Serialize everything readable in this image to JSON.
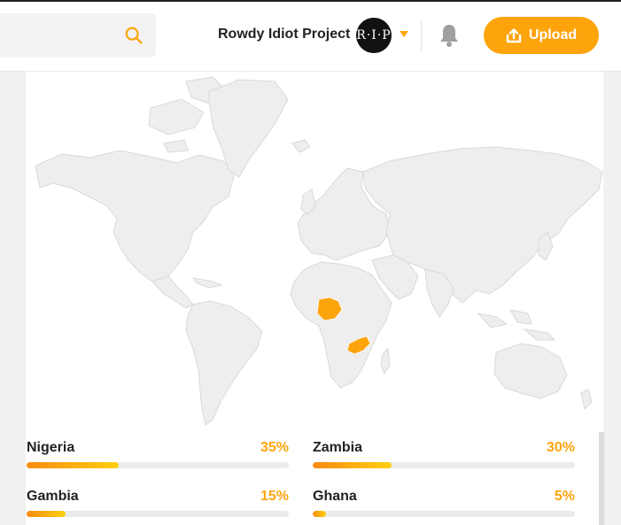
{
  "header": {
    "project_name": "Rowdy Idiot Project",
    "avatar_text": "R·I·P",
    "upload_label": "Upload",
    "accent_color": "#fda40d"
  },
  "icons": {
    "search": "search-icon",
    "caret": "caret-down-icon",
    "bell": "bell-icon",
    "upload": "upload-icon"
  },
  "map": {
    "highlighted_countries": [
      "Nigeria",
      "Zambia"
    ],
    "land_color": "#eeeeee",
    "highlight_color": "#fda40d"
  },
  "stats": [
    {
      "country": "Nigeria",
      "percent_label": "35%",
      "percent": 35
    },
    {
      "country": "Zambia",
      "percent_label": "30%",
      "percent": 30
    },
    {
      "country": "Gambia",
      "percent_label": "15%",
      "percent": 15
    },
    {
      "country": "Ghana",
      "percent_label": "5%",
      "percent": 5
    }
  ]
}
